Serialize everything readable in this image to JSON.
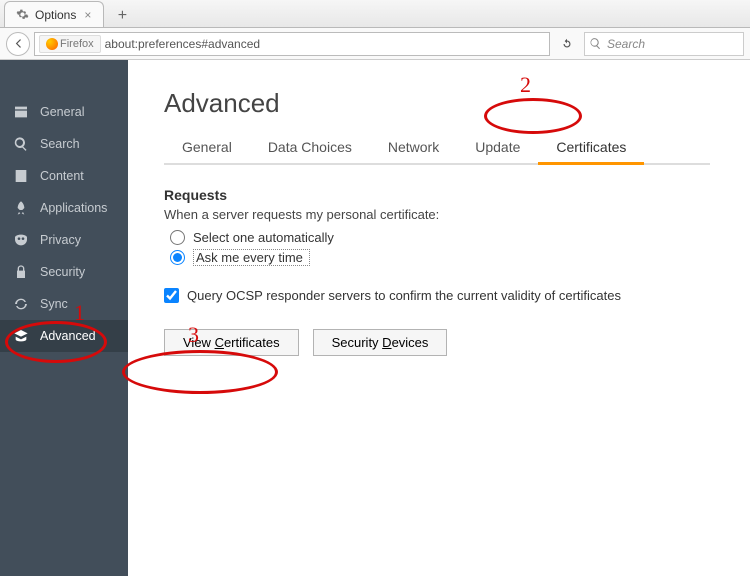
{
  "browser": {
    "tab_title": "Options",
    "identity_label": "Firefox",
    "url": "about:preferences#advanced",
    "search_placeholder": "Search"
  },
  "sidebar": {
    "items": [
      {
        "label": "General"
      },
      {
        "label": "Search"
      },
      {
        "label": "Content"
      },
      {
        "label": "Applications"
      },
      {
        "label": "Privacy"
      },
      {
        "label": "Security"
      },
      {
        "label": "Sync"
      },
      {
        "label": "Advanced"
      }
    ]
  },
  "page": {
    "heading": "Advanced",
    "tabs": {
      "general": "General",
      "data_choices": "Data Choices",
      "network": "Network",
      "update": "Update",
      "certificates": "Certificates"
    },
    "requests": {
      "title": "Requests",
      "desc": "When a server requests my personal certificate:",
      "opt_auto": "Select one automatically",
      "opt_ask": "Ask me every time"
    },
    "ocsp_label": "Query OCSP responder servers to confirm the current validity of certificates",
    "buttons": {
      "view_cert_pre": "View ",
      "view_cert_u": "C",
      "view_cert_post": "ertificates",
      "sec_dev_pre": "Security ",
      "sec_dev_u": "D",
      "sec_dev_post": "evices"
    }
  },
  "annotations": {
    "n1": "1",
    "n2": "2",
    "n3": "3"
  }
}
